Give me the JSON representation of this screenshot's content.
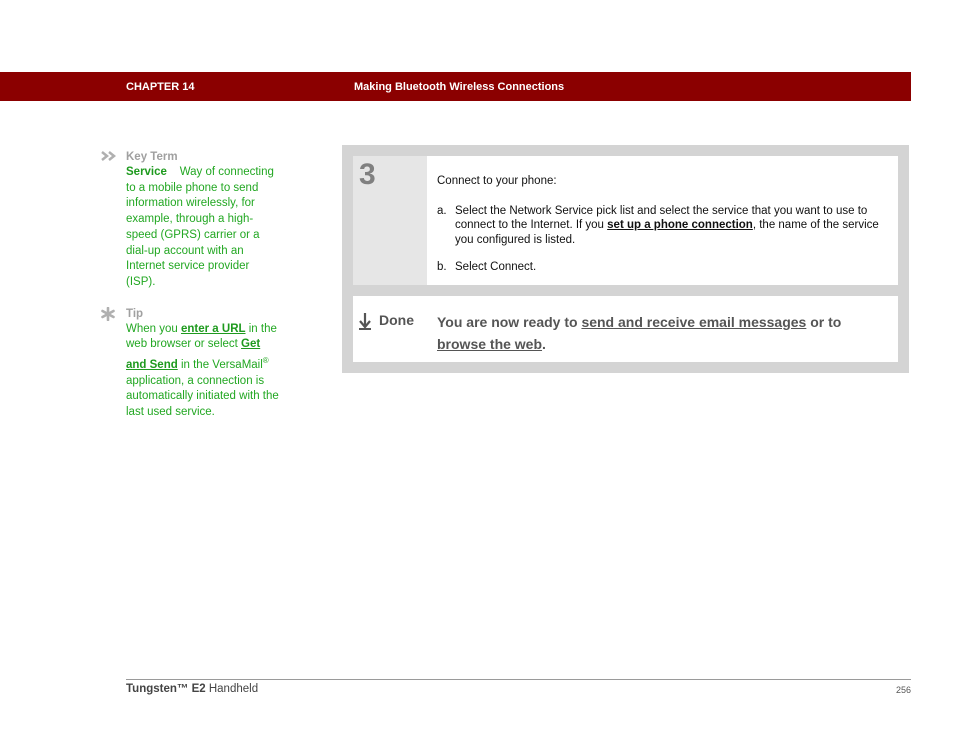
{
  "header": {
    "chapter": "CHAPTER 14",
    "section": "Making Bluetooth Wireless Connections",
    "bar_color": "#8b0000"
  },
  "sidebar": {
    "key_term": {
      "icon": "double-chevron-icon",
      "heading": "Key Term",
      "term": "Service",
      "definition": "Way of connecting to a mobile phone to send information wirelessly, for example, through a high-speed (GPRS) carrier or a dial-up account with an Internet service provider (ISP)."
    },
    "tip": {
      "icon": "asterisk-icon",
      "heading": "Tip",
      "text_before": "When you ",
      "link1": "enter a URL",
      "text_mid1": " in the web browser or select ",
      "link2": "Get and Send",
      "text_mid2": " in the VersaMail",
      "registered": "®",
      "text_after": " application, a connection is automatically initiated with the last used service."
    },
    "text_color": "#22a722"
  },
  "step": {
    "number": "3",
    "intro": "Connect to your phone:",
    "items": [
      {
        "label": "a.",
        "text_before": "Select the Network Service pick list and select the service that you want to use to connect to the Internet. If you ",
        "link": "set up a phone connection",
        "text_after": ", the name of the service you configured is listed."
      },
      {
        "label": "b.",
        "text": "Select Connect."
      }
    ]
  },
  "done": {
    "icon": "down-arrow-icon",
    "label": "Done",
    "text_before": "You are now ready to ",
    "link1": "send and receive email messages",
    "text_mid": " or to ",
    "link2": "browse the web",
    "text_after": "."
  },
  "footer": {
    "brand": "Tungsten™ E2",
    "product": " Handheld",
    "page": "256"
  }
}
